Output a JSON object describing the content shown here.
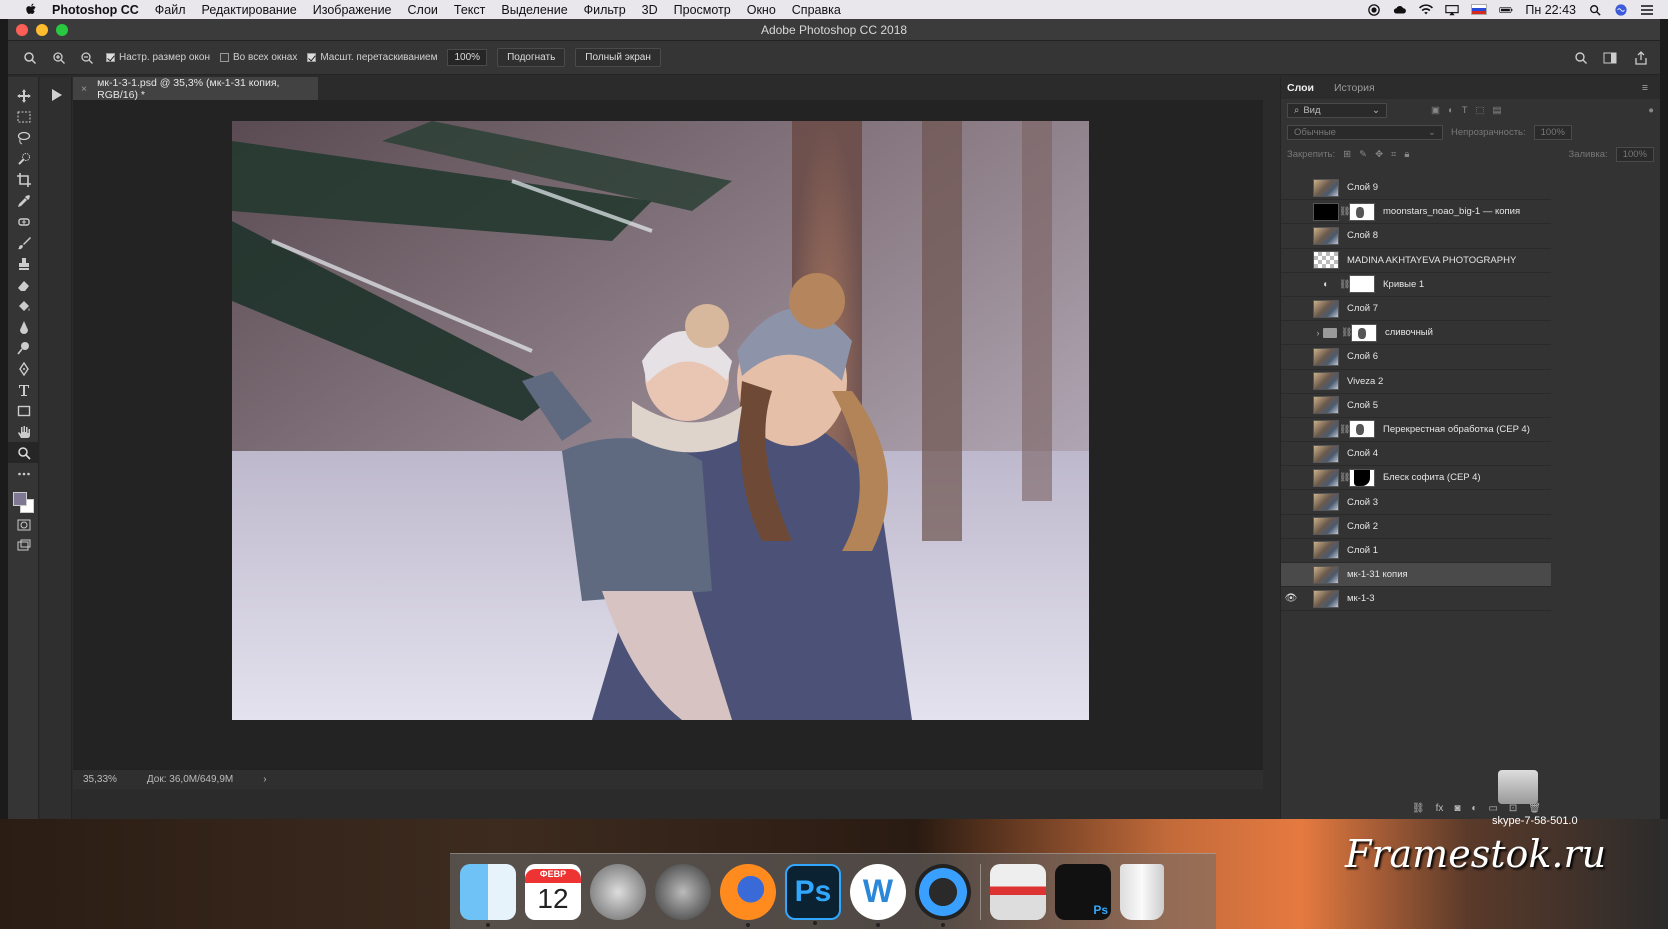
{
  "menubar": {
    "app_name": "Photoshop CC",
    "items": [
      "Файл",
      "Редактирование",
      "Изображение",
      "Слои",
      "Текст",
      "Выделение",
      "Фильтр",
      "3D",
      "Просмотр",
      "Окно",
      "Справка"
    ],
    "clock": "Пн 22:43"
  },
  "window": {
    "title": "Adobe Photoshop CC 2018"
  },
  "options": {
    "check_resize": "Настр. размер окон",
    "check_all_windows": "Во всех окнах",
    "check_scrubby": "Масшт. перетаскиванием",
    "zoom_value": "100%",
    "fit_button": "Подогнать",
    "fullscreen_button": "Полный экран"
  },
  "document": {
    "tab_title": "мк-1-3-1.psd @ 35,3% (мк-1-31 копия, RGB/16) *",
    "zoom": "35,33%",
    "doc_info": "Док: 36,0M/649,9M"
  },
  "panel": {
    "tabs": [
      "Слои",
      "История"
    ],
    "filter_label": "Вид",
    "blend_mode": "Обычные",
    "opacity_label": "Непрозрачность:",
    "opacity_value": "100%",
    "lock_label": "Закрепить:",
    "fill_label": "Заливка:",
    "fill_value": "100%"
  },
  "layers": [
    {
      "name": "Слой 9",
      "thumb": "photo"
    },
    {
      "name": "moonstars_noao_big-1 — копия",
      "thumb": "black",
      "mask": "mask"
    },
    {
      "name": "Слой 8",
      "thumb": "photo"
    },
    {
      "name": "MADINA  AKHTAYEVA  PHOTOGRAPHY",
      "thumb": "checker"
    },
    {
      "name": "Кривые 1",
      "thumb": "adjust",
      "mask": "white"
    },
    {
      "name": "Слой 7",
      "thumb": "photo"
    },
    {
      "name": "сливочный",
      "thumb": "folder",
      "mask": "mask"
    },
    {
      "name": "Слой 6",
      "thumb": "photo"
    },
    {
      "name": "Viveza 2",
      "thumb": "photo"
    },
    {
      "name": "Слой 5",
      "thumb": "photo"
    },
    {
      "name": "Перекрестная обработка (CEP 4)",
      "thumb": "photo",
      "mask": "mask"
    },
    {
      "name": "Слой 4",
      "thumb": "photo"
    },
    {
      "name": "Блеск софита (CEP 4)",
      "thumb": "photo",
      "mask": "blackmask"
    },
    {
      "name": "Слой 3",
      "thumb": "photo"
    },
    {
      "name": "Слой 2",
      "thumb": "photo"
    },
    {
      "name": "Слой 1",
      "thumb": "photo"
    },
    {
      "name": "мк-1-31 копия",
      "thumb": "photo",
      "selected": true
    },
    {
      "name": "мк-1-3",
      "thumb": "photo",
      "visible": true
    }
  ],
  "dock": {
    "calendar_month": "ФЕВР",
    "calendar_day": "12",
    "ps_label": "Ps",
    "wunder_label": "W",
    "stack_label": "Ps"
  },
  "watermark": {
    "skype": "skype-7-58-501.0",
    "site": "Framestok.ru"
  }
}
